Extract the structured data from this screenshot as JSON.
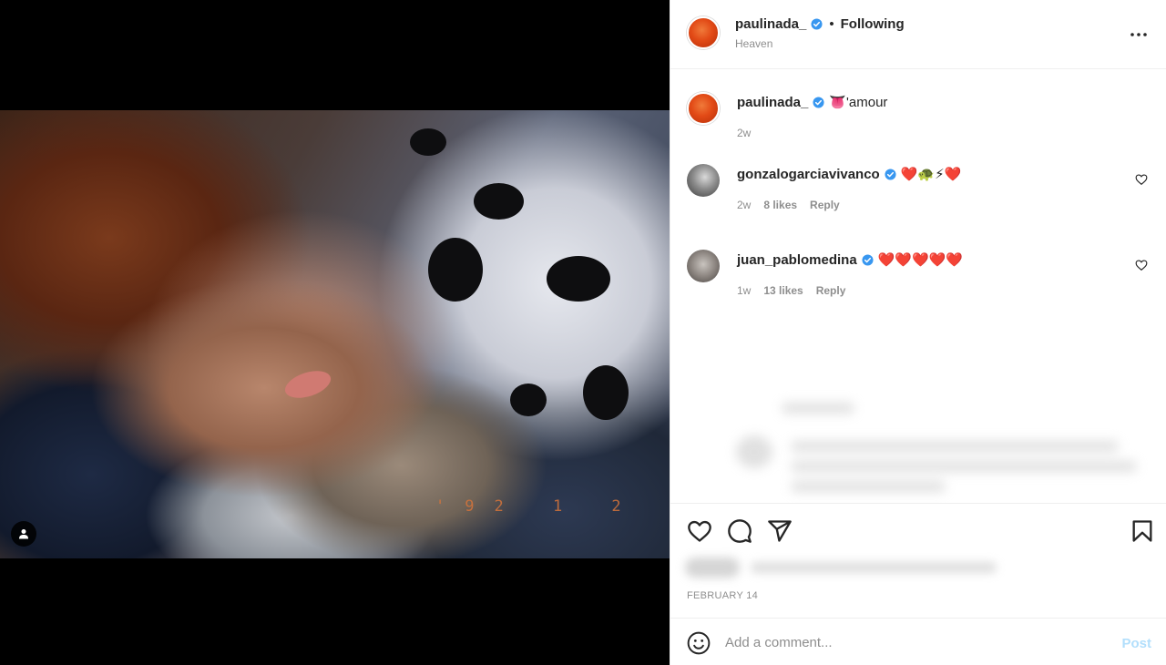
{
  "post": {
    "username": "paulinada_",
    "follow_separator": "•",
    "follow_status": "Following",
    "location": "Heaven",
    "caption_emoji": "👅",
    "caption_text": "'amour",
    "caption_age": "2w",
    "date": "FEBRUARY 14",
    "photo_stamp": "'92  1  2"
  },
  "comments": [
    {
      "username": "gonzalogarciavivanco",
      "emojis": "❤️🐢⚡❤️",
      "age": "2w",
      "likes": "8 likes",
      "reply": "Reply"
    },
    {
      "username": "juan_pablomedina",
      "emojis": "❤️❤️❤️❤️❤️",
      "age": "1w",
      "likes": "13 likes",
      "reply": "Reply"
    }
  ],
  "composer": {
    "placeholder": "Add a comment...",
    "post_label": "Post"
  },
  "colors": {
    "verified": "#3897f0",
    "post_disabled": "#b2dffc",
    "heart": "#ed4956"
  },
  "icons": [
    "user-tag-icon",
    "verified-badge-icon",
    "more-options-icon",
    "heart-icon",
    "comment-icon",
    "share-icon",
    "bookmark-icon",
    "emoji-icon"
  ]
}
